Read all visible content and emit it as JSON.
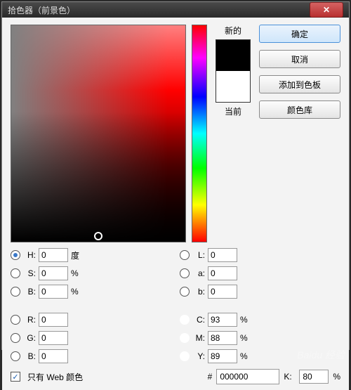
{
  "window": {
    "title": "拾色器（前景色）"
  },
  "buttons": {
    "ok": "确定",
    "cancel": "取消",
    "add_swatch": "添加到色板",
    "color_lib": "颜色库"
  },
  "preview": {
    "new_label": "新的",
    "current_label": "当前",
    "new_color": "#000000",
    "current_color": "#ffffff"
  },
  "hsb": {
    "h": {
      "label": "H:",
      "value": "0",
      "unit": "度",
      "selected": true
    },
    "s": {
      "label": "S:",
      "value": "0",
      "unit": "%",
      "selected": false
    },
    "b": {
      "label": "B:",
      "value": "0",
      "unit": "%",
      "selected": false
    }
  },
  "lab": {
    "l": {
      "label": "L:",
      "value": "0",
      "selected": false
    },
    "a": {
      "label": "a:",
      "value": "0",
      "selected": false
    },
    "b": {
      "label": "b:",
      "value": "0",
      "selected": false
    }
  },
  "rgb": {
    "r": {
      "label": "R:",
      "value": "0",
      "selected": false
    },
    "g": {
      "label": "G:",
      "value": "0",
      "unit": "%",
      "selected": false
    },
    "b": {
      "label": "B:",
      "value": "0",
      "unit": "%",
      "selected": false
    }
  },
  "cmyk": {
    "c": {
      "label": "C:",
      "value": "93",
      "unit": "%"
    },
    "m": {
      "label": "M:",
      "value": "88",
      "unit": "%"
    },
    "y": {
      "label": "Y:",
      "value": "89",
      "unit": "%"
    },
    "k": {
      "label": "K:",
      "value": "80",
      "unit": "%"
    }
  },
  "hex": {
    "prefix": "#",
    "value": "000000"
  },
  "web_only": {
    "label": "只有 Web 颜色",
    "checked": true
  },
  "watermark": "Baidu 经验"
}
